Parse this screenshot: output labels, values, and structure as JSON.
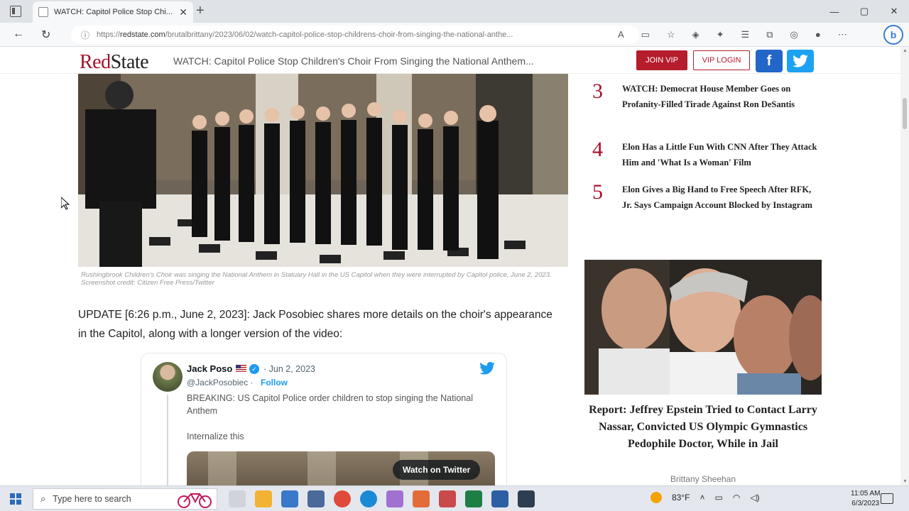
{
  "browser": {
    "tab_title": "WATCH: Capitol Police Stop Chi...",
    "tab_close": "✕",
    "new_tab": "+",
    "url_prefix": "https://",
    "url_domain": "redstate.com",
    "url_path": "/brutalbrittany/2023/06/02/watch-capitol-police-stop-childrens-choir-from-singing-the-national-anthe...",
    "win_min": "—",
    "win_max": "▢",
    "win_close": "✕"
  },
  "site": {
    "logo_red": "Red",
    "logo_dark": "State",
    "header_headline": "WATCH: Capitol Police Stop Children's Choir From Singing the National Anthem...",
    "join_vip": "JOIN VIP",
    "vip_login": "VIP LOGIN",
    "facebook_glyph": "f"
  },
  "article": {
    "caption": "Rushingbrook Children's Choir was singing the National Anthem in Statuary Hall in the US Capitol when they were interrupted by Capitol police, June 2, 2023. Screenshot credit: Citizen Free Press/Twitter",
    "update_text": "UPDATE [6:26 p.m., June 2, 2023]: Jack Posobiec shares more details on the choir's appearance in the Capitol, along with a longer version of the video:"
  },
  "tweet": {
    "name": "Jack Poso",
    "verified_glyph": "✓",
    "date": "· Jun 2, 2023",
    "handle": "@JackPosobiec ·",
    "follow": "Follow",
    "body1": "BREAKING: US Capitol Police order children to stop singing the National Anthem",
    "body2": "Internalize this",
    "watch_label": "Watch on Twitter"
  },
  "sidebar": {
    "trending": [
      {
        "num": "3",
        "text": "WATCH: Democrat House Member Goes on Profanity-Filled Tirade Against Ron DeSantis"
      },
      {
        "num": "4",
        "text": "Elon Has a Little Fun With CNN After They Attack Him and 'What Is a Woman' Film"
      },
      {
        "num": "5",
        "text": "Elon Gives a Big Hand to Free Speech After RFK, Jr. Says Campaign Account Blocked by Instagram"
      }
    ],
    "feature_title": "Report: Jeffrey Epstein Tried to Contact Larry Nassar, Convicted US Olympic Gymnastics Pedophile Doctor, While in Jail",
    "feature_author": "Brittany Sheehan"
  },
  "taskbar": {
    "search_placeholder": "Type here to search",
    "weather": "83°F",
    "time": "11:05 AM",
    "date": "6/3/2023"
  },
  "colors": {
    "brand_red": "#a8102c",
    "facebook": "#2266c7",
    "twitter": "#1da1f2",
    "link_blue": "#1d9bf0"
  }
}
